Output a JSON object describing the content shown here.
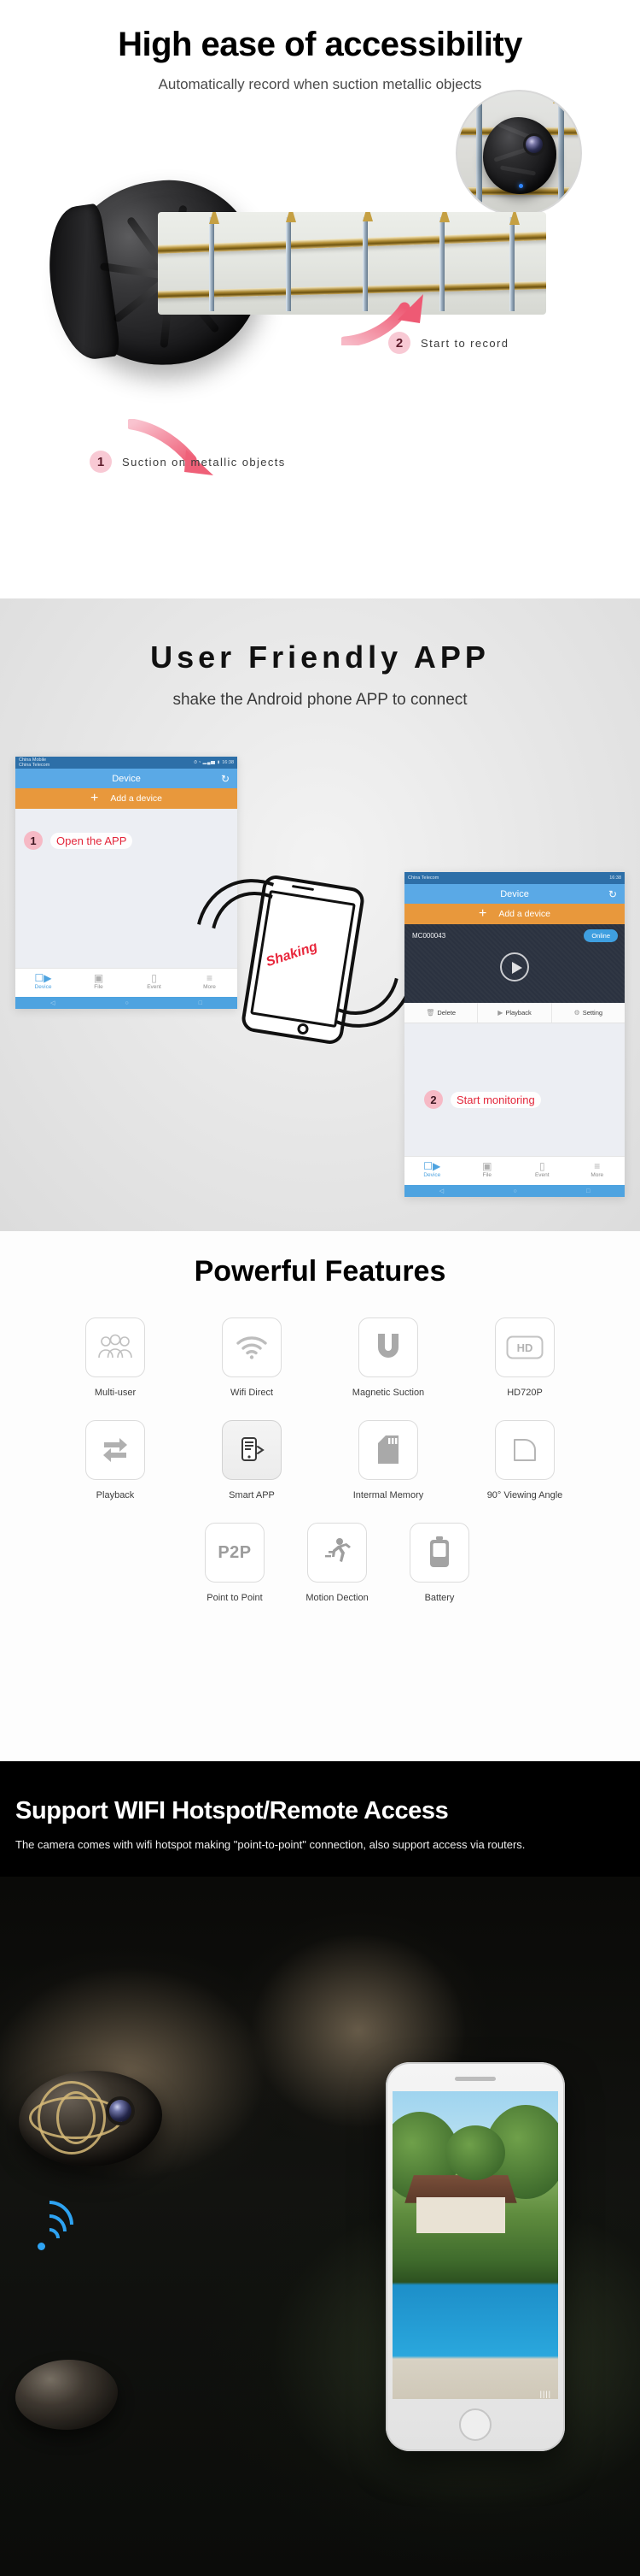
{
  "accessibility": {
    "title": "High ease of accessibility",
    "subtitle": "Automatically record when suction metallic objects",
    "steps": [
      {
        "num": "1",
        "label": "Suction on metallic objects"
      },
      {
        "num": "2",
        "label": "Start to record"
      }
    ]
  },
  "app": {
    "title": "User Friendly APP",
    "subtitle": "shake the Android phone APP to connect",
    "shaking_label": "Shaking",
    "phone_left": {
      "status_carrier_line1": "China Mobile",
      "status_carrier_line2": "China Telecom",
      "status_icons": "⏱ ᵛ ▂▄▆ ▮",
      "status_time": "16:38",
      "header_title": "Device",
      "refresh_icon": "refresh-icon",
      "add_device": "Add a device",
      "add_plus": "+",
      "nav": [
        {
          "label": "Device",
          "icon": "camera-icon",
          "active": "true"
        },
        {
          "label": "File",
          "icon": "image-icon",
          "active": "false"
        },
        {
          "label": "Event",
          "icon": "message-icon",
          "active": "false"
        },
        {
          "label": "More",
          "icon": "list-icon",
          "active": "false"
        }
      ],
      "callout": {
        "num": "1",
        "text": "Open the APP"
      }
    },
    "phone_right": {
      "status_carrier": "China Telecom",
      "status_time": "16:38",
      "header_title": "Device",
      "add_device": "Add a device",
      "add_plus": "+",
      "device_id": "MC000043",
      "status_badge": "Online",
      "play_icon": "play-icon",
      "actions": [
        {
          "label": "Delete",
          "icon": "trash-icon"
        },
        {
          "label": "Playback",
          "icon": "play-box-icon"
        },
        {
          "label": "Setting",
          "icon": "gear-icon"
        }
      ],
      "nav": [
        {
          "label": "Device",
          "icon": "camera-icon",
          "active": "true"
        },
        {
          "label": "File",
          "icon": "image-icon",
          "active": "false"
        },
        {
          "label": "Event",
          "icon": "message-icon",
          "active": "false"
        },
        {
          "label": "More",
          "icon": "list-icon",
          "active": "false"
        }
      ],
      "callout": {
        "num": "2",
        "text": "Start monitoring"
      }
    }
  },
  "features": {
    "title": "Powerful Features",
    "rows": [
      [
        {
          "label": "Multi-user",
          "icon": "multi-user-icon"
        },
        {
          "label": "Wifi Direct",
          "icon": "wifi-icon"
        },
        {
          "label": "Magnetic Suction",
          "icon": "magnet-u-icon"
        },
        {
          "label": "HD720P",
          "icon": "hd-icon"
        }
      ],
      [
        {
          "label": "Playback",
          "icon": "playback-arrows-icon"
        },
        {
          "label": "Smart APP",
          "icon": "smart-app-icon"
        },
        {
          "label": "Intermal Memory",
          "icon": "sd-card-icon"
        },
        {
          "label": "90° Viewing Angle",
          "icon": "viewing-angle-icon"
        }
      ],
      [
        {
          "label": "Point to Point",
          "icon": "p2p-icon",
          "text": "P2P"
        },
        {
          "label": "Motion Dection",
          "icon": "running-person-icon"
        },
        {
          "label": "Battery",
          "icon": "battery-icon"
        }
      ]
    ]
  },
  "wifi": {
    "title": "Support WIFI Hotspot/Remote Access",
    "description": "The camera comes with wifi hotspot making \"point-to-point\" connection, also support access via routers.",
    "signal_icon": "wifi-signal-icon",
    "battery_indicator": "||||"
  },
  "colors": {
    "accent_pink": "#f8c9d4",
    "accent_red": "#e3263a",
    "app_blue": "#5aa9e6",
    "app_orange": "#e8983c",
    "online_blue": "#3f9fe0",
    "dark_panel": "#2b3240",
    "wifi_blue": "#2ea3f2"
  }
}
